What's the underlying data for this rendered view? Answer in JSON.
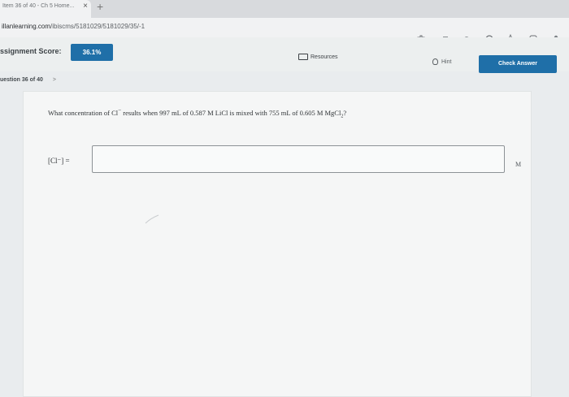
{
  "browser": {
    "tab_title": "Item 36 of 40 - Ch 5 Home...",
    "tab_close": "×",
    "new_tab": "+",
    "url_host": "illanlearning.com",
    "url_path": "/ibiscms/5181029/5181029/35/-1"
  },
  "toolbar_icons": [
    "extension-icon",
    "notification-icon",
    "dot-icon",
    "refresh-icon",
    "star-icon",
    "collection-icon",
    "profile-icon"
  ],
  "header": {
    "score_label": "ssignment Score:",
    "score_value": "36.1%",
    "resources_label": "Resources",
    "hint_label": "Hint",
    "check_answer_label": "Check Answer"
  },
  "question_nav": {
    "label": "uestion 36 of 40",
    "chevron": ">"
  },
  "question": {
    "prefix": "What concentration of Cl",
    "ion_charge": "−",
    "text_mid": " results when 997 mL of 0.587 M LiCl is mixed with 755 mL of 0.605 M MgCl",
    "subscript": "2",
    "suffix": "?"
  },
  "answer": {
    "label": "[Cl⁻] =",
    "value": "",
    "placeholder": "",
    "unit": "M"
  },
  "colors": {
    "accent": "#1f6fa8",
    "background": "#e9ecee",
    "panel": "#f5f6f6"
  }
}
